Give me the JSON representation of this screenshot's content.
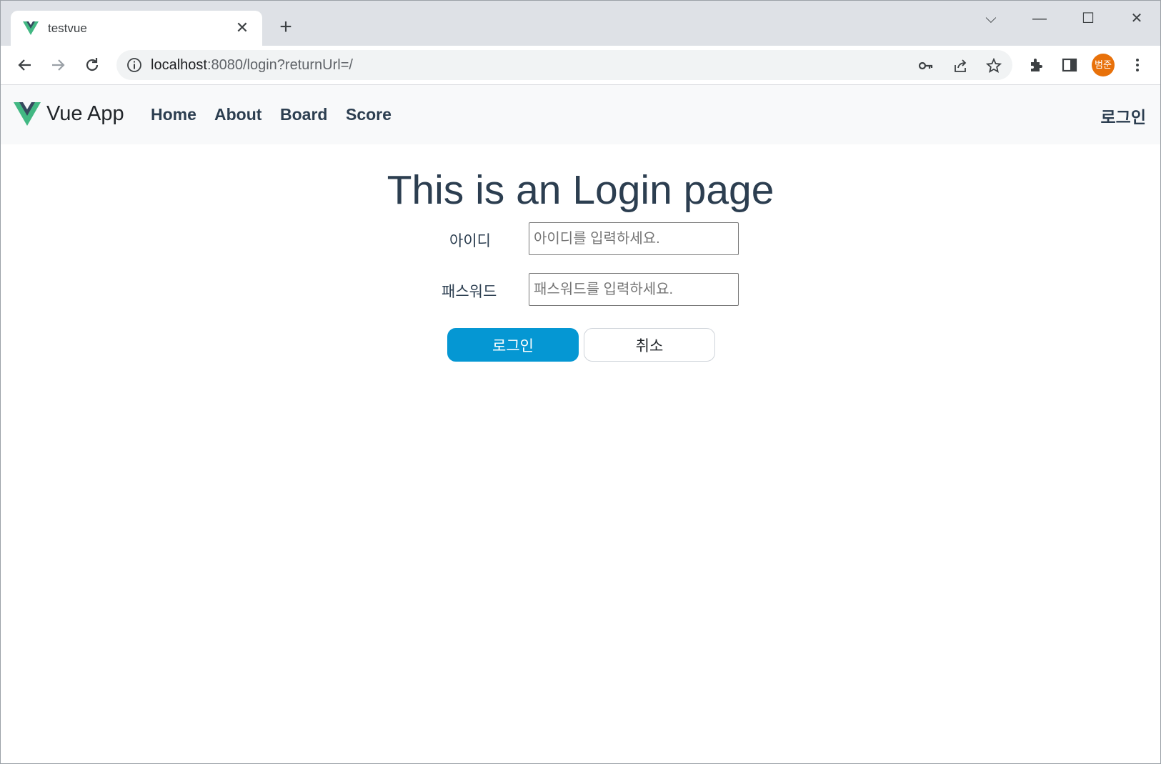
{
  "browser": {
    "tab": {
      "title": "testvue",
      "close_glyph": "✕"
    },
    "new_tab_glyph": "+",
    "window_controls": {
      "tabsearch": "⌵",
      "minimize": "—",
      "maximize": "☐",
      "close": "✕"
    },
    "url": {
      "host": "localhost",
      "rest": ":8080/login?returnUrl=/"
    },
    "profile_initials": "범준",
    "profile_color": "#e8710a"
  },
  "app": {
    "brand": "Vue App",
    "nav": [
      {
        "label": "Home"
      },
      {
        "label": "About"
      },
      {
        "label": "Board"
      },
      {
        "label": "Score"
      }
    ],
    "login_link": "로그인",
    "vue_green": "#42b883",
    "vue_dark": "#35495e"
  },
  "login": {
    "title": "This is an Login page",
    "id_label": "아이디",
    "id_placeholder": "아이디를 입력하세요.",
    "pw_label": "패스워드",
    "pw_placeholder": "패스워드를 입력하세요.",
    "login_button": "로그인",
    "cancel_button": "취소",
    "login_button_color": "#0597d3"
  }
}
